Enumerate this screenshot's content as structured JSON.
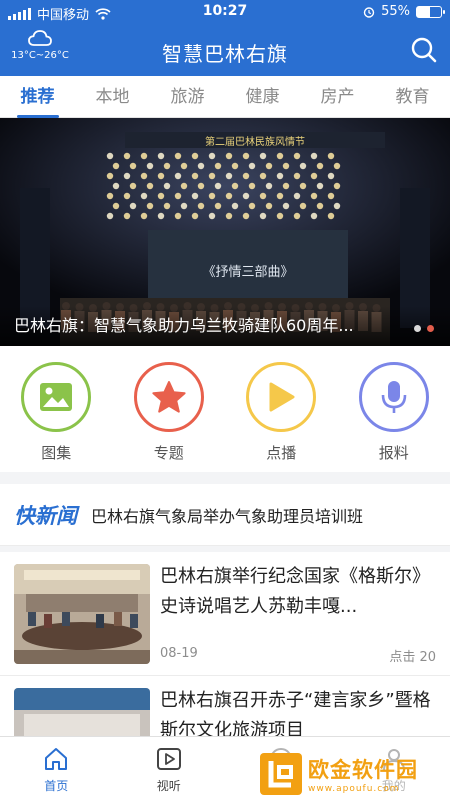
{
  "status_bar": {
    "carrier": "中国移动",
    "time": "10:27",
    "battery": "55%",
    "battery_level": 0.55
  },
  "header": {
    "weather_icon": "cloud-icon",
    "temperature": "13°C~26°C",
    "title": "智慧巴林右旗",
    "search_icon": "search-icon"
  },
  "tabs": [
    {
      "label": "推荐",
      "active": true
    },
    {
      "label": "本地"
    },
    {
      "label": "旅游"
    },
    {
      "label": "健康"
    },
    {
      "label": "房产"
    },
    {
      "label": "教育"
    }
  ],
  "banner": {
    "stage_sign": "第二届巴林民族风情节",
    "stage_screen": "《抒情三部曲》",
    "caption": "巴林右旗：智慧气象助力乌兰牧骑建队60周年..."
  },
  "entries": [
    {
      "label": "图集",
      "icon": "image-icon",
      "color": "#8bc34a"
    },
    {
      "label": "专题",
      "icon": "star-icon",
      "color": "#e8604c"
    },
    {
      "label": "点播",
      "icon": "play-icon",
      "color": "#f5c84a"
    },
    {
      "label": "报料",
      "icon": "microphone-icon",
      "color": "#7b86e8"
    }
  ],
  "news_flash": {
    "logo": "快新闻",
    "text": "巴林右旗气象局举办气象助理员培训班"
  },
  "news": [
    {
      "title": "巴林右旗举行纪念国家《格斯尔》史诗说唱艺人苏勒丰嘎...",
      "date": "08-19",
      "views": "点击 20"
    },
    {
      "title": "巴林右旗召开赤子“建言家乡”暨格斯尔文化旅游项目",
      "date": "",
      "views": ""
    }
  ],
  "bottom_nav": [
    {
      "label": "首页",
      "icon": "home-icon",
      "active": true
    },
    {
      "label": "视听",
      "icon": "video-icon"
    },
    {
      "label": "",
      "icon": "center-icon"
    },
    {
      "label": "我的",
      "icon": "user-icon"
    }
  ],
  "watermark": {
    "title": "欧金软件园",
    "url": "www.apoufu.com"
  },
  "colors": {
    "primary": "#2a6fd1",
    "banner_dot_active": "#e25d4c"
  }
}
